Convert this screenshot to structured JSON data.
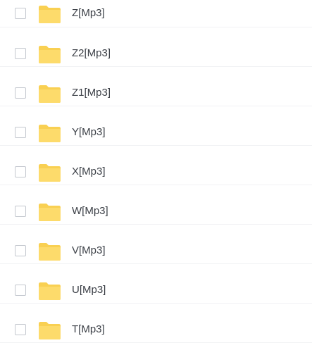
{
  "file_list": {
    "items": [
      {
        "name": "Z[Mp3]",
        "type_icon": "folder-icon",
        "checked": false
      },
      {
        "name": "Z2[Mp3]",
        "type_icon": "folder-icon",
        "checked": false
      },
      {
        "name": "Z1[Mp3]",
        "type_icon": "folder-icon",
        "checked": false
      },
      {
        "name": "Y[Mp3]",
        "type_icon": "folder-icon",
        "checked": false
      },
      {
        "name": "X[Mp3]",
        "type_icon": "folder-icon",
        "checked": false
      },
      {
        "name": "W[Mp3]",
        "type_icon": "folder-icon",
        "checked": false
      },
      {
        "name": "V[Mp3]",
        "type_icon": "folder-icon",
        "checked": false
      },
      {
        "name": "U[Mp3]",
        "type_icon": "folder-icon",
        "checked": false
      },
      {
        "name": "T[Mp3]",
        "type_icon": "folder-icon",
        "checked": false
      }
    ]
  },
  "colors": {
    "folder_back": "#F9D052",
    "folder_front": "#FDDB6B",
    "text": "#3B3F46",
    "divider": "#F1F2F4",
    "checkbox_border": "#C4C8CF"
  }
}
